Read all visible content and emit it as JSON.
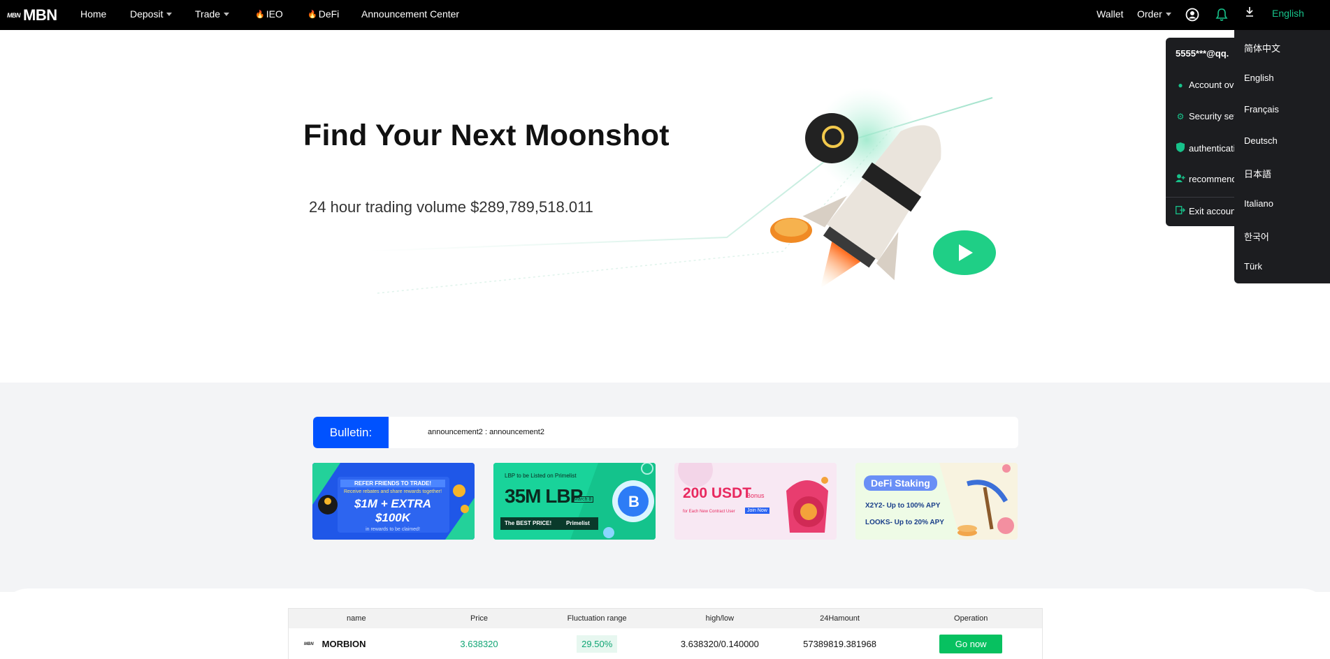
{
  "nav": {
    "logo_mark": "MBN",
    "logo_text": "MBN",
    "items": [
      {
        "label": "Home"
      },
      {
        "label": "Deposit"
      },
      {
        "label": "Trade"
      },
      {
        "label": "IEO"
      },
      {
        "label": "DeFi"
      },
      {
        "label": "Announcement Center"
      }
    ],
    "wallet": "Wallet",
    "order": "Order",
    "language": "English",
    "icons": [
      "user-circle-icon",
      "bell-icon",
      "download-icon"
    ],
    "accent": "#17c28a"
  },
  "hero": {
    "title": "Find Your Next Moonshot",
    "volume": "24 hour trading volume $289,789,518.011"
  },
  "bulletin": {
    "label": "Bulletin:",
    "text": "announcement2 : announcement2",
    "accent": "#0052ff"
  },
  "banners": [
    {
      "line1": "REFER FRIENDS TO TRADE!",
      "line2": "Receive rebates and share rewards together!",
      "line3": "$1M + EXTRA $100K",
      "line4": "in rewards to be claimed!"
    },
    {
      "line1": "LBP to be Listed on Primelist",
      "line2": "35M LBP",
      "line3": "March 8",
      "line4": "The BEST PRICE!",
      "line5": "Primelist"
    },
    {
      "line1": "200 USDT",
      "line2": "Bonus",
      "line3": "for Each New Contract User",
      "line4": "Join Now"
    },
    {
      "line1": "DeFi Staking",
      "line2": "X2Y2- Up to 100% APY",
      "line3": "LOOKS- Up to 20% APY"
    }
  ],
  "market": {
    "headers": [
      "name",
      "Price",
      "Fluctuation range",
      "high/low",
      "24Hamount",
      "Operation"
    ],
    "rows": [
      {
        "logo": "MBN",
        "name": "MORBION",
        "price": "3.638320",
        "change": "29.50%",
        "highlow": "3.638320/0.140000",
        "amount": "57389819.381968",
        "action": "Go now"
      }
    ]
  },
  "account_menu": {
    "email": "5555***@qq.",
    "items": [
      {
        "label": "Account ove",
        "icon": "user-icon"
      },
      {
        "label": "Security set",
        "icon": "gear-icon"
      },
      {
        "label": "authenticatio",
        "icon": "shield-icon"
      },
      {
        "label": "recommend",
        "icon": "user-plus-icon"
      }
    ],
    "exit": {
      "label": "Exit accoun",
      "icon": "logout-icon"
    }
  },
  "language_menu": {
    "items": [
      "简体中文",
      "English",
      "Français",
      "Deutsch",
      "日本語",
      "Italiano",
      "한국어",
      "Türk"
    ]
  }
}
